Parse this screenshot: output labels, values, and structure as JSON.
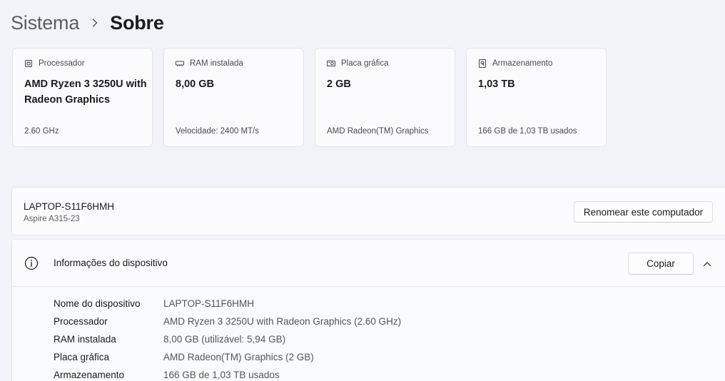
{
  "breadcrumb": {
    "parent": "Sistema",
    "current": "Sobre"
  },
  "specs": [
    {
      "label": "Processador",
      "icon": "processor-icon",
      "value": "AMD Ryzen 3 3250U with Radeon Graphics",
      "sub": "2.60 GHz"
    },
    {
      "label": "RAM instalada",
      "icon": "ram-icon",
      "value": "8,00 GB",
      "sub": "Velocidade: 2400 MT/s"
    },
    {
      "label": "Placa gráfica",
      "icon": "graphics-card-icon",
      "value": "2 GB",
      "sub": "AMD Radeon(TM) Graphics"
    },
    {
      "label": "Armazenamento",
      "icon": "storage-icon",
      "value": "1,03 TB",
      "sub": "166 GB de 1,03 TB usados"
    }
  ],
  "device": {
    "name": "LAPTOP-S11F6HMH",
    "model": "Aspire A315-23",
    "rename_label": "Renomear este computador"
  },
  "info": {
    "title": "Informações do dispositivo",
    "copy_label": "Copiar",
    "rows": [
      {
        "key": "Nome do dispositivo",
        "value": "LAPTOP-S11F6HMH"
      },
      {
        "key": "Processador",
        "value": "AMD Ryzen 3 3250U with Radeon Graphics (2.60 GHz)"
      },
      {
        "key": "RAM instalada",
        "value": "8,00 GB (utilizável: 5,94 GB)"
      },
      {
        "key": "Placa gráfica",
        "value": "AMD Radeon(TM) Graphics (2 GB)"
      },
      {
        "key": "Armazenamento",
        "value": "166 GB de 1,03 TB usados"
      }
    ]
  }
}
